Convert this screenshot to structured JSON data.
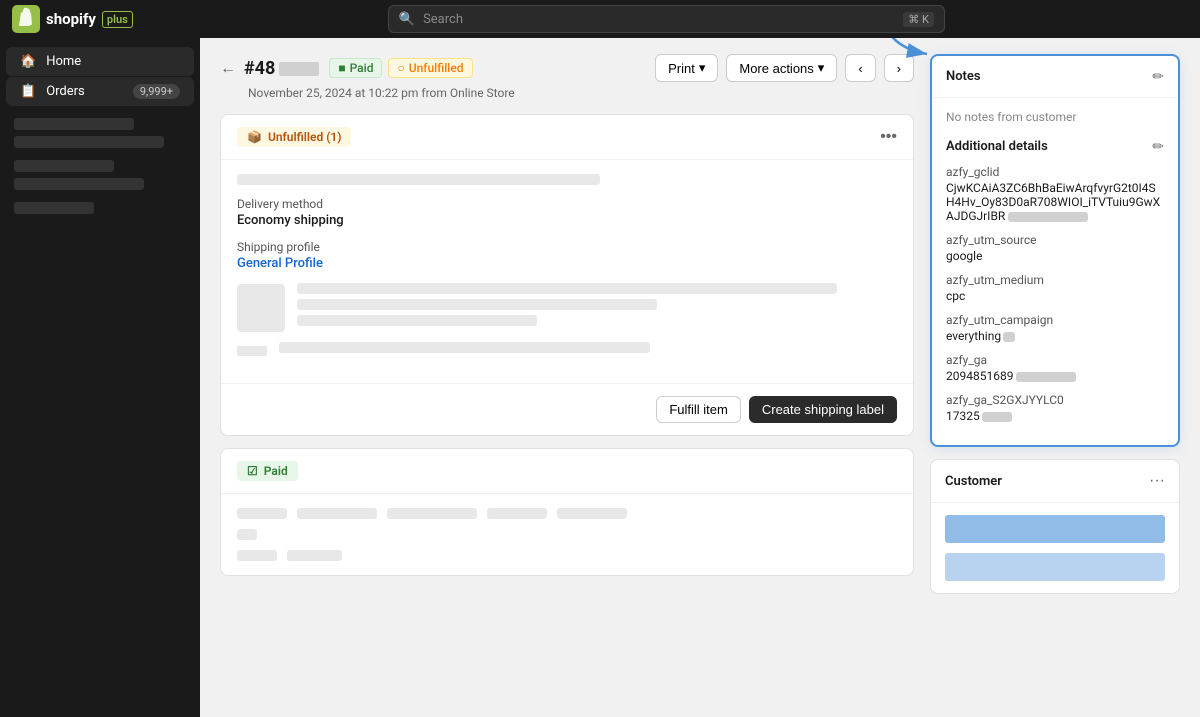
{
  "topnav": {
    "logo_text": "shopify",
    "logo_plus": "plus",
    "search_placeholder": "Search",
    "shortcut": "⌘ K"
  },
  "sidebar": {
    "items": [
      {
        "label": "Home",
        "icon": "🏠",
        "active": false
      },
      {
        "label": "Orders",
        "icon": "📋",
        "active": true,
        "badge": "9,999+"
      }
    ]
  },
  "order": {
    "back_label": "←",
    "number": "#48",
    "paid_label": "Paid",
    "unfulfilled_label": "Unfulfilled",
    "meta": "November 25, 2024 at 10:22 pm from Online Store",
    "print_label": "Print",
    "more_actions_label": "More actions"
  },
  "unfulfilled_card": {
    "header_label": "Unfulfilled (1)",
    "delivery_method_label": "Delivery method",
    "delivery_method_value": "Economy shipping",
    "shipping_profile_label": "Shipping profile",
    "shipping_profile_link": "General Profile",
    "fulfill_item_label": "Fulfill item",
    "create_shipping_label": "Create shipping label"
  },
  "paid_card": {
    "header_label": "Paid"
  },
  "notes_card": {
    "title": "Notes",
    "no_notes_text": "No notes from customer",
    "additional_details_title": "Additional details",
    "details": [
      {
        "key": "azfy_gclid",
        "value": "CjwKCAiA3ZC6BhBaEiwArqfvyrG2t0I4SH4Hv_Oy83D0aR708WIOI_iTVTuiu9GwXAJDGJrIBR",
        "has_blur": true
      },
      {
        "key": "azfy_utm_source",
        "value": "google",
        "has_blur": false
      },
      {
        "key": "azfy_utm_medium",
        "value": "cpc",
        "has_blur": false
      },
      {
        "key": "azfy_utm_campaign",
        "value": "everything",
        "has_blur": true,
        "blur_suffix": true
      },
      {
        "key": "azfy_ga",
        "value": "2094851689",
        "has_blur": true
      },
      {
        "key": "azfy_ga_S2GXJYYLC0",
        "value": "17325",
        "has_blur": true,
        "blur_suffix": true
      }
    ]
  },
  "customer_card": {
    "title": "Customer",
    "menu_icon": "···"
  }
}
